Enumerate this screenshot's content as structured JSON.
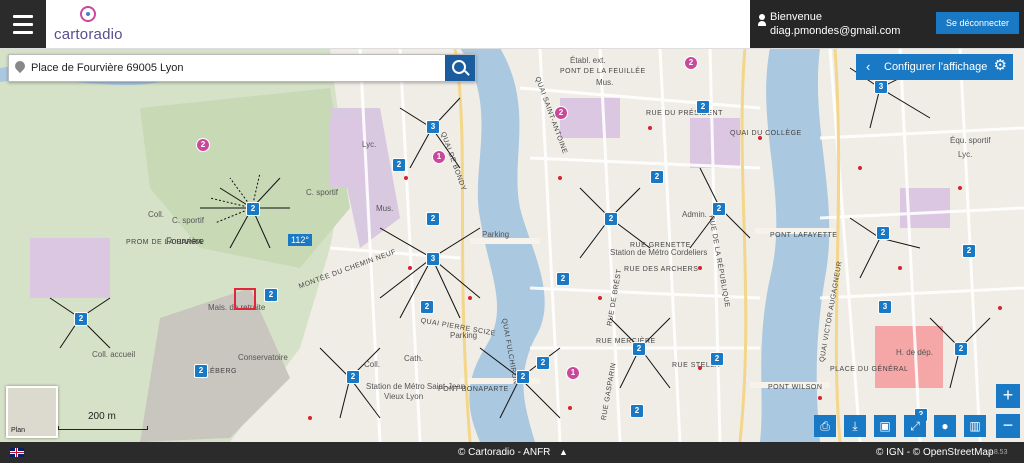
{
  "header": {
    "menu_icon": "hamburger-icon",
    "logo_text": "cartoradio",
    "welcome": "Bienvenue",
    "email": "diag.pmondes@gmail.com",
    "logout_label": "Se déconnecter"
  },
  "search": {
    "value": "Place de Fourvière 69005 Lyon",
    "button_icon": "search-icon"
  },
  "config": {
    "label": "Configurer l'affichage",
    "back_icon": "chevron-left-icon",
    "settings_icon": "gear-icon"
  },
  "map": {
    "places": [
      "Fourvière",
      "Conservatoire",
      "Parking",
      "Parking",
      "Station de Métro Saint-Jean",
      "Vieux Lyon",
      "Station de Métro Cordeliers",
      "Admin.",
      "Lyc.",
      "Lyc.",
      "Coll.",
      "Coll.",
      "Coll. accueil",
      "C. sportif",
      "C. sportif",
      "Cath.",
      "Mus.",
      "H. de dép.",
      "Équ. sportif",
      "Mais. de retraite",
      "Mus.",
      "Établ. ext."
    ],
    "streets": [
      "PONT LAFAYETTE",
      "PONT WILSON",
      "PONT BONAPARTE",
      "QUAI PIERRE SCIZE",
      "PROM DE LA SARRA",
      "MONTÉE DU CHEMIN NEUF",
      "QUAI SAINT-ANTOINE",
      "RUE DU PRÉSIDENT",
      "QUAI DU COLLÈGE",
      "QUAI FULCHIRON",
      "RUE DE LA RÉPUBLIQUE",
      "RUE DE BRÉST",
      "CLÉBERG",
      "QUAI VICTOR AUGAGNEUR",
      "PONT DE LA FEUILLÉE",
      "RUE GASPARIN",
      "RUE MERCIÈRE",
      "RUE GRENETTE",
      "RUE STELLA",
      "PLACE DU GÉNÉRAL",
      "QUAI DE BONDY",
      "RUE DES ARCHERS"
    ],
    "highlight_label": "112°",
    "markers": [
      "2",
      "3",
      "2",
      "2",
      "3",
      "2",
      "2",
      "2",
      "2",
      "2",
      "2",
      "2",
      "2",
      "2",
      "2",
      "2",
      "2",
      "2",
      "3",
      "2",
      "3",
      "2",
      "2",
      "2",
      "2",
      "2"
    ],
    "pink_markers": [
      "2",
      "2",
      "1",
      "1",
      "2"
    ],
    "minimap_label": "Plan",
    "scale": "200 m"
  },
  "tools": {
    "print_icon": "printer-icon",
    "download_icon": "download-icon",
    "save_icon": "floppy-icon",
    "fullscreen_icon": "fullscreen-icon",
    "locate_icon": "pin-icon",
    "measure_icon": "ruler-icon",
    "zoom_in": "+",
    "zoom_out": "−"
  },
  "footer": {
    "language_icon": "uk-flag-icon",
    "center_credit": "© Cartoradio - ANFR",
    "expand_icon": "chevron-up-icon",
    "right_credit": "© IGN - © OpenStreetMap",
    "version": "4.8.53"
  },
  "colors": {
    "accent": "#1a79c4",
    "dark": "#2b2b2b",
    "pink": "#c9489b",
    "river": "#aac8e0",
    "hospital": "#f5a7a7"
  }
}
